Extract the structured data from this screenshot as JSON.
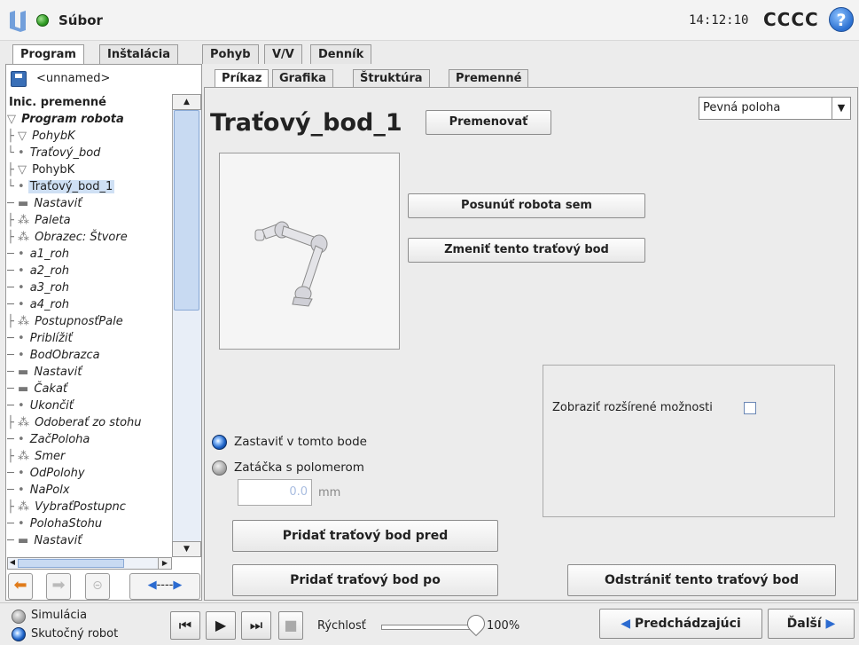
{
  "app": {
    "title": "Súbor",
    "clock": "14:12:10",
    "robot_name": "CCCC",
    "help": "?"
  },
  "tabs": [
    "Program",
    "Inštalácia",
    "Pohyb",
    "V/V",
    "Denník"
  ],
  "subtabs": [
    "Príkaz",
    "Grafika",
    "Štruktúra",
    "Premenné"
  ],
  "program_name": "<unnamed>",
  "tree": [
    {
      "text": "Inic. premenné",
      "prefix": "",
      "style": "b"
    },
    {
      "text": "Program robota",
      "prefix": "▽ ",
      "style": "bi"
    },
    {
      "text": "PohybK",
      "prefix": "├ ▽ ",
      "style": "i"
    },
    {
      "text": "Traťový_bod",
      "prefix": "   └ • ",
      "style": "i"
    },
    {
      "text": "PohybK",
      "prefix": "├ ▽ ",
      "style": ""
    },
    {
      "text": "Traťový_bod_1",
      "prefix": "   └ • ",
      "style": "sel"
    },
    {
      "text": "Nastaviť",
      "prefix": "─ ▬ ",
      "style": "i"
    },
    {
      "text": "Paleta",
      "prefix": "├ ⁂ ",
      "style": "i"
    },
    {
      "text": "Obrazec: Štvore",
      "prefix": "  ├ ⁂ ",
      "style": "i"
    },
    {
      "text": "a1_roh",
      "prefix": "     ─ • ",
      "style": "i"
    },
    {
      "text": "a2_roh",
      "prefix": "     ─ • ",
      "style": "i"
    },
    {
      "text": "a3_roh",
      "prefix": "     ─ • ",
      "style": "i"
    },
    {
      "text": "a4_roh",
      "prefix": "     ─ • ",
      "style": "i"
    },
    {
      "text": "PostupnosťPale",
      "prefix": "  ├ ⁂ ",
      "style": "i"
    },
    {
      "text": "Priblížiť",
      "prefix": "     ─ • ",
      "style": "i"
    },
    {
      "text": "BodObrazca",
      "prefix": "     ─ • ",
      "style": "i"
    },
    {
      "text": "Nastaviť",
      "prefix": "     ─ ▬ ",
      "style": "i"
    },
    {
      "text": "Čakať",
      "prefix": "     ─ ▬ ",
      "style": "i"
    },
    {
      "text": "Ukončiť",
      "prefix": "     ─ • ",
      "style": "i"
    },
    {
      "text": "Odoberať zo stohu",
      "prefix": "├ ⁂ ",
      "style": "i"
    },
    {
      "text": "ZačPoloha",
      "prefix": "   ─ • ",
      "style": "i"
    },
    {
      "text": "Smer",
      "prefix": "  ├ ⁂ ",
      "style": "i"
    },
    {
      "text": "OdPolohy",
      "prefix": "     ─ • ",
      "style": "i"
    },
    {
      "text": "NaPolx",
      "prefix": "     ─ • ",
      "style": "i"
    },
    {
      "text": "VybraťPostupnc",
      "prefix": "  ├ ⁂ ",
      "style": "i"
    },
    {
      "text": "PolohaStohu",
      "prefix": "     ─ • ",
      "style": "i"
    },
    {
      "text": "Nastaviť",
      "prefix": "     ─ ▬ ",
      "style": "i"
    }
  ],
  "command": {
    "title": "Traťový_bod_1",
    "rename": "Premenovať",
    "position_type": "Pevná poloha",
    "move_here": "Posunúť robota sem",
    "change_waypoint": "Zmeniť tento traťový bod",
    "show_advanced": "Zobraziť rozšírené možnosti",
    "stop_here": "Zastaviť v tomto bode",
    "blend_radius": "Zatáčka s polomerom",
    "radius_value": "0.0",
    "radius_unit": "mm",
    "add_before": "Pridať traťový bod pred",
    "add_after": "Pridať traťový bod po",
    "remove": "Odstrániť tento traťový bod"
  },
  "footer": {
    "simulation": "Simulácia",
    "real_robot": "Skutočný robot",
    "speed_label": "Rýchlosť",
    "speed_value": "100%",
    "speed_fraction": 1.0,
    "prev": "Predchádzajúci",
    "next": "Ďalší"
  },
  "colors": {
    "accent": "#2c6bd0",
    "selection": "#cfe0f4",
    "status": "#2e9a22"
  }
}
